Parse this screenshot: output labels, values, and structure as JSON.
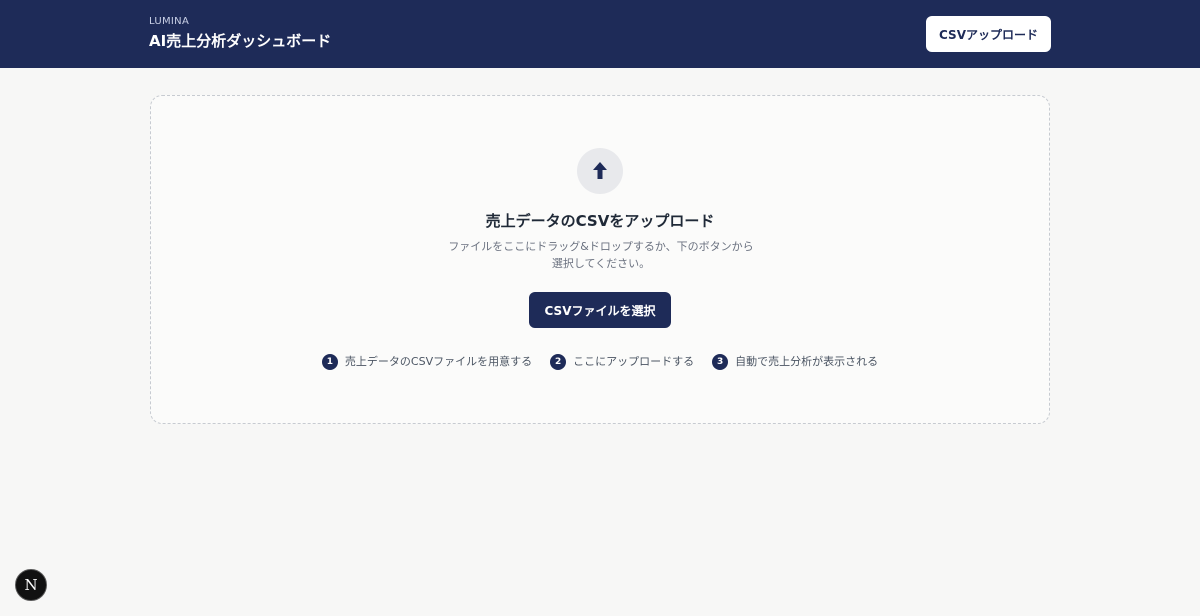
{
  "header": {
    "brand": "LUMINA",
    "title": "AI売上分析ダッシュボード",
    "upload_label": "CSVアップロード"
  },
  "dropzone": {
    "icon": "upload-arrow-icon",
    "title": "売上データのCSVをアップロード",
    "description": "ファイルをここにドラッグ&ドロップするか、下のボタンから選択してください。",
    "select_label": "CSVファイルを選択",
    "steps": [
      {
        "number": "1",
        "text": "売上データのCSVファイルを用意する"
      },
      {
        "number": "2",
        "text": "ここにアップロードする"
      },
      {
        "number": "3",
        "text": "自動で売上分析が表示される"
      }
    ]
  },
  "dev_badge": {
    "label": "N",
    "icon": "nextjs-dev-icon"
  },
  "colors": {
    "header_bg": "#1e2b58",
    "page_bg": "#f7f7f6",
    "accent": "#1e2b58"
  }
}
